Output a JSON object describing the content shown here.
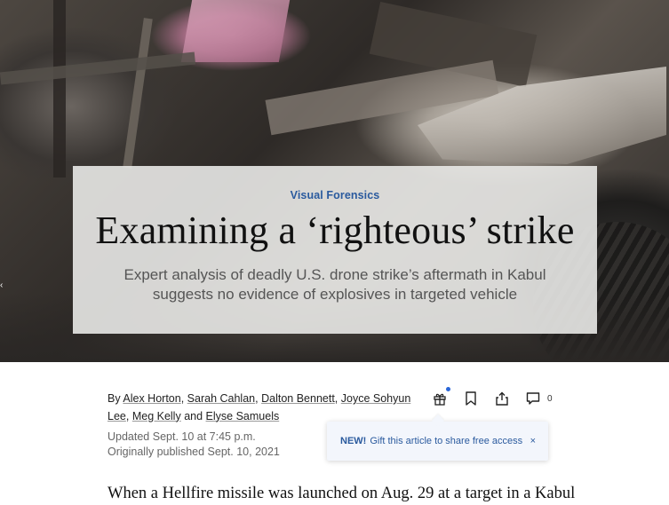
{
  "hero": {
    "kicker": "Visual Forensics",
    "headline": "Examining a ‘righteous’ strike",
    "dek": "Expert analysis of deadly U.S. drone strike’s aftermath in Kabul suggests no evidence of explosives in targeted vehicle"
  },
  "byline": {
    "prefix": "By",
    "authors": [
      "Alex Horton",
      "Sarah Cahlan",
      "Dalton Bennett",
      "Joyce Sohyun Lee",
      "Meg Kelly",
      "Elyse Samuels"
    ],
    "sep_comma": ",",
    "sep_and": "and"
  },
  "actions": {
    "gift_icon": "gift-icon",
    "bookmark_icon": "bookmark-icon",
    "share_icon": "share-icon",
    "comment_icon": "comment-icon",
    "comment_count": "0"
  },
  "dates": {
    "updated": "Updated Sept. 10 at 7:45 p.m.",
    "published": "Originally published Sept. 10, 2021"
  },
  "gift_tooltip": {
    "badge": "NEW!",
    "text": "Gift this article to share free access",
    "close": "×"
  },
  "article": {
    "first_line": "When a Hellfire missile was launched on Aug. 29 at a target in a Kabul"
  },
  "colors": {
    "accent": "#2a5a9e",
    "dot": "#2a66d8"
  }
}
